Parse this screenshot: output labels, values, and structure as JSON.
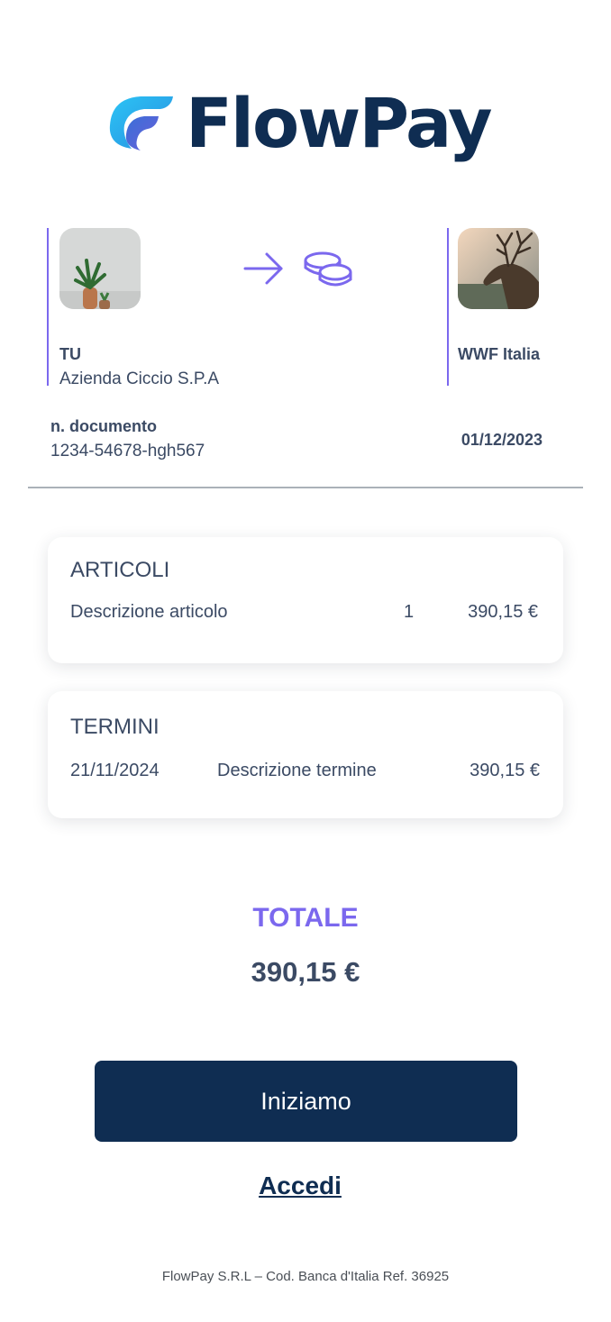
{
  "brand": {
    "name": "FlowPay",
    "colors": {
      "navy": "#0f2d52",
      "accent": "#7b68ee",
      "cyan": "#2bb4f0"
    }
  },
  "sender": {
    "role": "TU",
    "name": "Azienda Ciccio S.P.A",
    "avatar": "plant-photo"
  },
  "receiver": {
    "role": "WWF Italia",
    "avatar": "deer-photo"
  },
  "transfer": {
    "icons": [
      "arrow-right-icon",
      "coins-icon"
    ]
  },
  "document": {
    "label": "n. documento",
    "number": "1234-54678-hgh567",
    "date": "01/12/2023"
  },
  "articoli": {
    "title": "ARTICOLI",
    "rows": [
      {
        "description": "Descrizione articolo",
        "quantity": "1",
        "amount": "390,15 €"
      }
    ]
  },
  "termini": {
    "title": "TERMINI",
    "rows": [
      {
        "date": "21/11/2024",
        "description": "Descrizione termine",
        "amount": "390,15 €"
      }
    ]
  },
  "totale": {
    "label": "TOTALE",
    "value": "390,15 €"
  },
  "actions": {
    "start_label": "Iniziamo",
    "login_label": "Accedi"
  },
  "footer": {
    "text": "FlowPay S.R.L –  Cod. Banca d'Italia Ref. 36925"
  }
}
